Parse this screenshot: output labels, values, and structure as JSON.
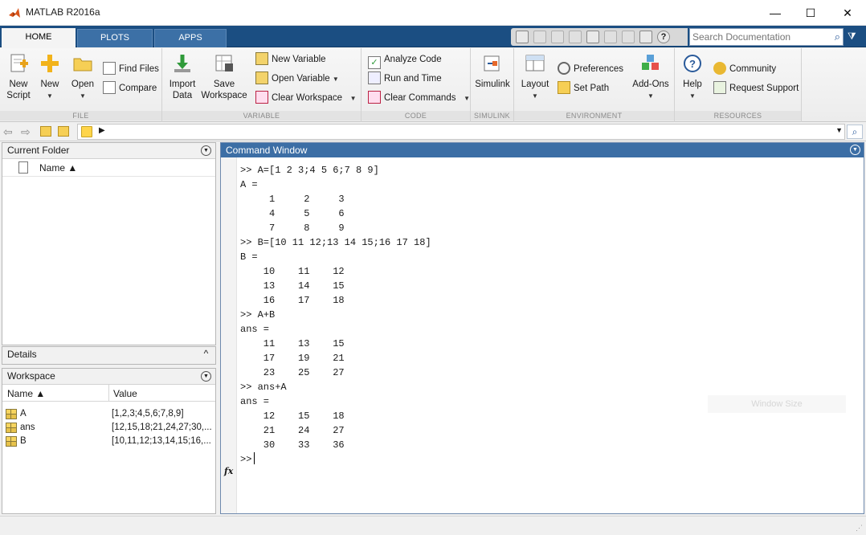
{
  "window": {
    "title": "MATLAB R2016a",
    "minimize": "—",
    "maximize": "☐",
    "close": "✕"
  },
  "tabs": [
    {
      "label": "HOME",
      "active": true
    },
    {
      "label": "PLOTS",
      "active": false
    },
    {
      "label": "APPS",
      "active": false
    }
  ],
  "search_doc": {
    "placeholder": "Search Documentation"
  },
  "ribbon": {
    "file": {
      "label": "FILE",
      "new_script": "New Script",
      "new_script_l1": "New",
      "new_script_l2": "Script",
      "new": "New",
      "open": "Open",
      "find_files": "Find Files",
      "compare": "Compare"
    },
    "variable": {
      "label": "VARIABLE",
      "import_l1": "Import",
      "import_l2": "Data",
      "save_l1": "Save",
      "save_l2": "Workspace",
      "new_variable": "New Variable",
      "open_variable": "Open Variable",
      "clear_workspace": "Clear Workspace"
    },
    "code": {
      "label": "CODE",
      "analyze_code": "Analyze Code",
      "run_and_time": "Run and Time",
      "clear_commands": "Clear Commands"
    },
    "simulink": {
      "label": "SIMULINK",
      "simulink": "Simulink"
    },
    "environment": {
      "label": "ENVIRONMENT",
      "layout": "Layout",
      "preferences": "Preferences",
      "set_path": "Set Path",
      "add_ons": "Add-Ons"
    },
    "resources": {
      "label": "RESOURCES",
      "help": "Help",
      "community": "Community",
      "request_support": "Request Support"
    }
  },
  "current_folder": {
    "title": "Current Folder",
    "column_name": "Name ▲"
  },
  "details": {
    "title": "Details"
  },
  "workspace": {
    "title": "Workspace",
    "col_name": "Name ▲",
    "col_value": "Value",
    "rows": [
      {
        "name": "A",
        "value": "[1,2,3;4,5,6;7,8,9]"
      },
      {
        "name": "ans",
        "value": "[12,15,18;21,24,27;30,..."
      },
      {
        "name": "B",
        "value": "[10,11,12;13,14,15;16,..."
      }
    ]
  },
  "command_window": {
    "title": "Command Window",
    "fx": "fx",
    "lines": [
      ">> A=[1 2 3;4 5 6;7 8 9]",
      "A =",
      "     1     2     3",
      "     4     5     6",
      "     7     8     9",
      ">> B=[10 11 12;13 14 15;16 17 18]",
      "B =",
      "    10    11    12",
      "    13    14    15",
      "    16    17    18",
      ">> A+B",
      "ans =",
      "    11    13    15",
      "    17    19    21",
      "    23    25    27",
      ">> ans+A",
      "ans =",
      "    12    15    18",
      "    21    24    27",
      "    30    33    36"
    ],
    "prompt": ">>",
    "ghost": "Window Size"
  }
}
